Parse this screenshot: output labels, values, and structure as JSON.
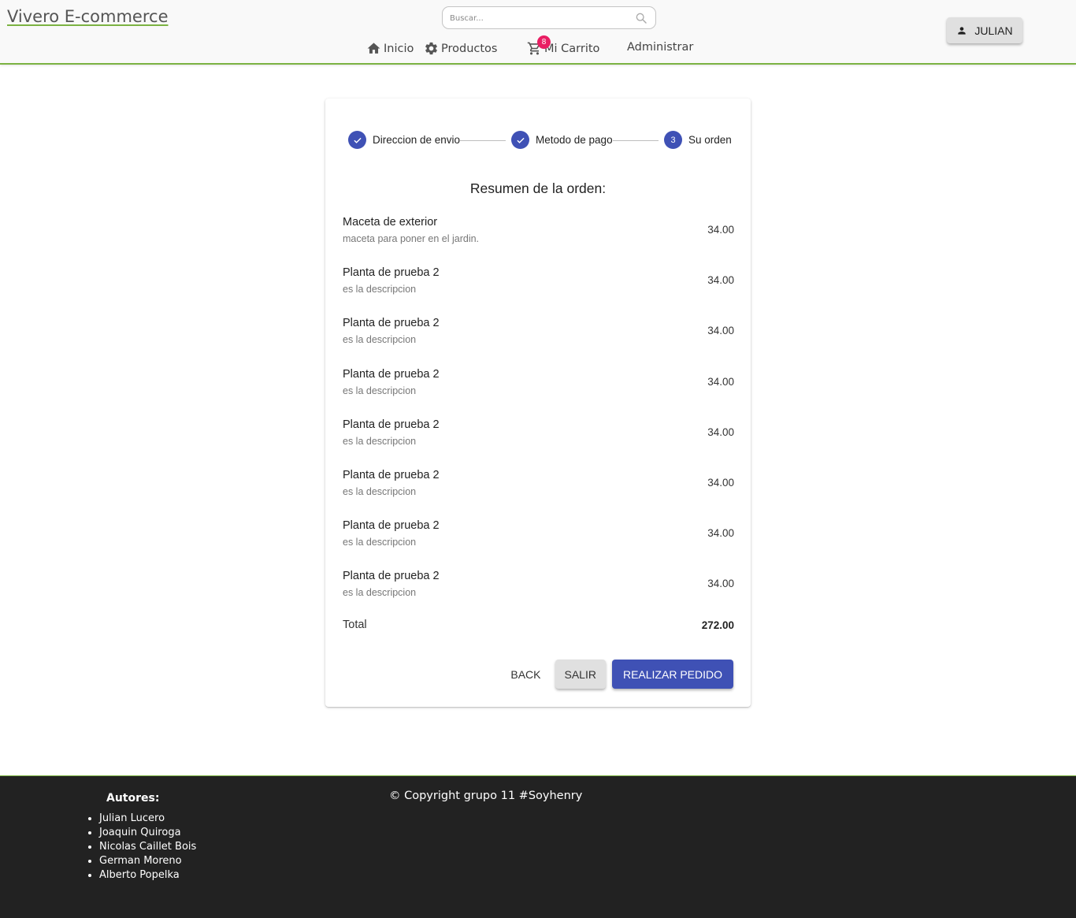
{
  "header": {
    "brand": "Vivero E-commerce",
    "search_placeholder": "Buscar...",
    "nav": {
      "inicio": "Inicio",
      "productos": "Productos",
      "carrito": "Mi Carrito",
      "administrar": "Administrar"
    },
    "cart_count": "8",
    "user_label": "JULIAN"
  },
  "stepper": {
    "steps": [
      {
        "label": "Direccion de envio",
        "state": "completed"
      },
      {
        "label": "Metodo de pago",
        "state": "completed"
      },
      {
        "label": "Su orden",
        "state": "active",
        "number": "3"
      }
    ]
  },
  "order": {
    "title": "Resumen de la orden:",
    "items": [
      {
        "name": "Maceta de exterior",
        "description": "maceta para poner en el jardin.",
        "price": "34.00"
      },
      {
        "name": "Planta de prueba 2",
        "description": "es la descripcion",
        "price": "34.00"
      },
      {
        "name": "Planta de prueba 2",
        "description": "es la descripcion",
        "price": "34.00"
      },
      {
        "name": "Planta de prueba 2",
        "description": "es la descripcion",
        "price": "34.00"
      },
      {
        "name": "Planta de prueba 2",
        "description": "es la descripcion",
        "price": "34.00"
      },
      {
        "name": "Planta de prueba 2",
        "description": "es la descripcion",
        "price": "34.00"
      },
      {
        "name": "Planta de prueba 2",
        "description": "es la descripcion",
        "price": "34.00"
      },
      {
        "name": "Planta de prueba 2",
        "description": "es la descripcion",
        "price": "34.00"
      }
    ],
    "total_label": "Total",
    "total_value": "272.00"
  },
  "actions": {
    "back": "BACK",
    "salir": "SALIR",
    "realizar": "REALIZAR PEDIDO"
  },
  "footer": {
    "authors_title": "Autores:",
    "authors": [
      "Julian Lucero",
      "Joaquin Quiroga",
      "Nicolas Caillet Bois",
      "German Moreno",
      "Alberto Popelka"
    ],
    "copyright": "© Copyright grupo 11 #Soyhenry"
  },
  "colors": {
    "primary": "#3f51b5",
    "accent_green": "#7cb342",
    "badge": "#e91e63",
    "footer_bg": "#222222"
  }
}
